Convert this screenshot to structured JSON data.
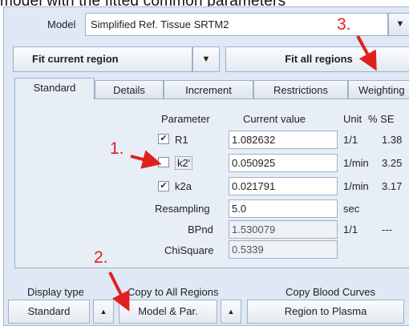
{
  "caption": "model with the fitted common parameters",
  "model": {
    "label": "Model",
    "value": "Simplified Ref. Tissue SRTM2",
    "arrow": "▼"
  },
  "fit": {
    "current_label": "Fit current region",
    "arrow": "▼",
    "all_label": "Fit all regions"
  },
  "tabs": [
    "Standard",
    "Details",
    "Increment",
    "Restrictions",
    "Weighting"
  ],
  "headers": {
    "parameter": "Parameter",
    "current_value": "Current value",
    "unit": "Unit",
    "se": "% SE"
  },
  "params": [
    {
      "name": "R1",
      "checked": true,
      "value": "1.082632",
      "unit": "1/1",
      "se": "1.38"
    },
    {
      "name": "k2'",
      "checked": false,
      "value": "0.050925",
      "unit": "1/min",
      "se": "3.25"
    },
    {
      "name": "k2a",
      "checked": true,
      "value": "0.021791",
      "unit": "1/min",
      "se": "3.17"
    }
  ],
  "extra": [
    {
      "name": "Resampling",
      "value": "5.0",
      "unit": "sec",
      "se": ""
    },
    {
      "name": "BPnd",
      "value": "1.530079",
      "unit": "1/1",
      "se": "---"
    },
    {
      "name": "ChiSquare",
      "value": "0.5339",
      "unit": "",
      "se": ""
    }
  ],
  "sections": {
    "display_type": "Display type",
    "copy_all": "Copy to All Regions",
    "copy_blood": "Copy Blood Curves"
  },
  "bottom": {
    "display": "Standard",
    "copy_all": "Model & Par.",
    "copy_blood": "Region to Plasma",
    "arrow": "▲"
  },
  "annotations": [
    "1.",
    "2.",
    "3."
  ],
  "colors": {
    "annotation": "#e02020",
    "panel": "#dfe8f4",
    "border": "#9fb0c6"
  }
}
